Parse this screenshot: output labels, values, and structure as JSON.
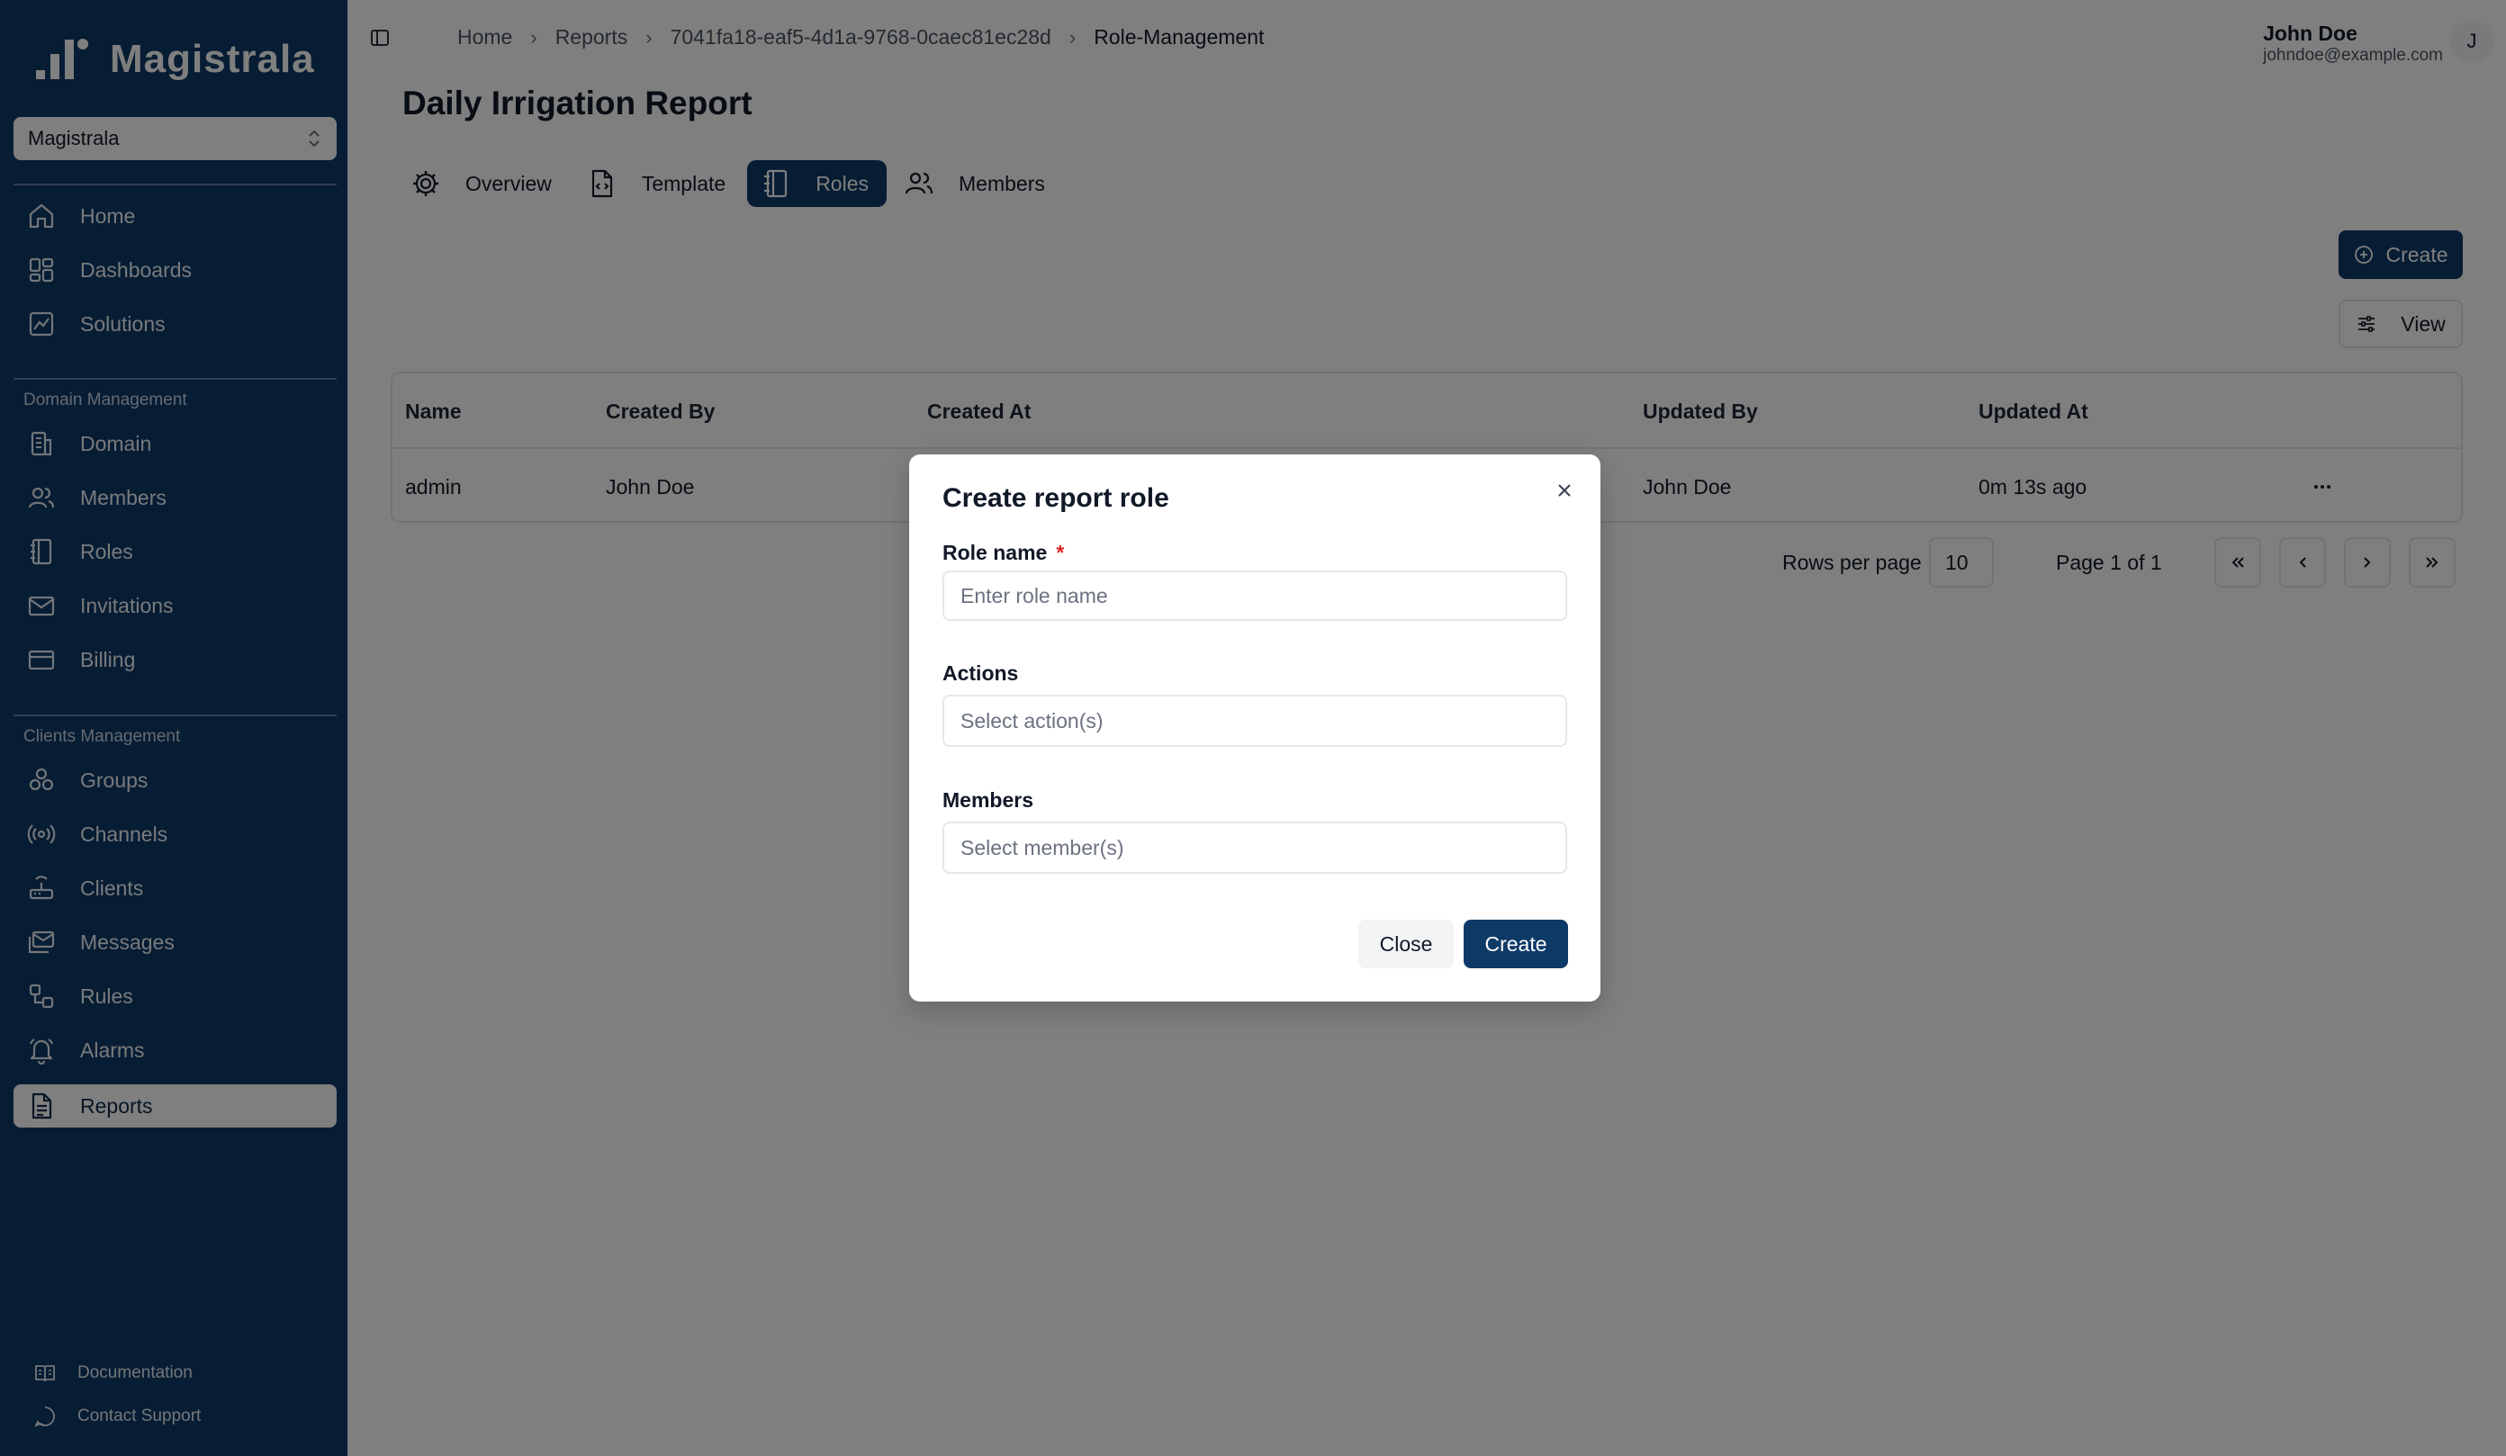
{
  "brand": {
    "name": "Magistrala"
  },
  "workspace": {
    "selected": "Magistrala"
  },
  "sidebar": {
    "main_items": [
      {
        "label": "Home",
        "icon": "home-icon"
      },
      {
        "label": "Dashboards",
        "icon": "dashboard-icon"
      },
      {
        "label": "Solutions",
        "icon": "solutions-icon"
      }
    ],
    "domain_section": "Domain Management",
    "domain_items": [
      {
        "label": "Domain",
        "icon": "building-icon"
      },
      {
        "label": "Members",
        "icon": "users-icon"
      },
      {
        "label": "Roles",
        "icon": "notebook-icon"
      },
      {
        "label": "Invitations",
        "icon": "mail-icon"
      },
      {
        "label": "Billing",
        "icon": "credit-card-icon"
      }
    ],
    "clients_section": "Clients Management",
    "clients_items": [
      {
        "label": "Groups",
        "icon": "groups-icon"
      },
      {
        "label": "Channels",
        "icon": "radio-icon"
      },
      {
        "label": "Clients",
        "icon": "router-icon"
      },
      {
        "label": "Messages",
        "icon": "mails-icon"
      },
      {
        "label": "Rules",
        "icon": "workflow-icon"
      },
      {
        "label": "Alarms",
        "icon": "bell-icon"
      },
      {
        "label": "Reports",
        "icon": "report-icon",
        "active": true
      }
    ],
    "footer": [
      {
        "label": "Documentation",
        "icon": "book-icon"
      },
      {
        "label": "Contact Support",
        "icon": "chat-icon"
      }
    ]
  },
  "breadcrumbs": [
    "Home",
    "Reports",
    "7041fa18-eaf5-4d1a-9768-0caec81ec28d",
    "Role-Management"
  ],
  "user": {
    "name": "John Doe",
    "email": "johndoe@example.com",
    "initial": "J"
  },
  "page": {
    "title": "Daily Irrigation Report"
  },
  "tabs": [
    {
      "label": "Overview",
      "icon": "gear-icon"
    },
    {
      "label": "Template",
      "icon": "file-code-icon"
    },
    {
      "label": "Roles",
      "icon": "notebook-icon",
      "active": true
    },
    {
      "label": "Members",
      "icon": "users-icon"
    }
  ],
  "toolbar": {
    "create_label": "Create",
    "view_label": "View"
  },
  "table": {
    "columns": [
      "Name",
      "Created By",
      "Created At",
      "Updated By",
      "Updated At"
    ],
    "rows": [
      {
        "name": "admin",
        "created_by": "John Doe",
        "created_at": "",
        "updated_by": "John Doe",
        "updated_at": "0m 13s ago"
      }
    ]
  },
  "pagination": {
    "rows_per_page_label": "Rows per page",
    "rows_per_page": "10",
    "page_info": "Page 1 of 1"
  },
  "modal": {
    "title": "Create report role",
    "role_name_label": "Role name",
    "required_mark": "*",
    "role_name_placeholder": "Enter role name",
    "actions_label": "Actions",
    "actions_placeholder": "Select action(s)",
    "members_label": "Members",
    "members_placeholder": "Select member(s)",
    "close_label": "Close",
    "create_label": "Create"
  },
  "colors": {
    "brand": "#0e3a68",
    "required": "#dc2626",
    "overlay": "rgba(0,0,0,0.5)"
  }
}
